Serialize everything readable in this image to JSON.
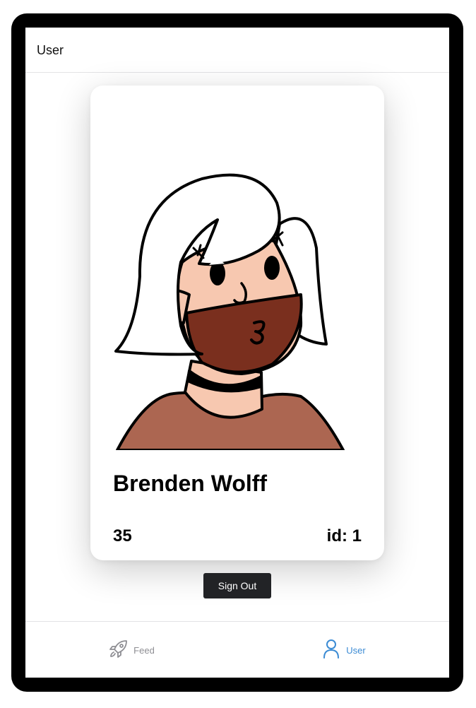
{
  "header": {
    "title": "User"
  },
  "profile": {
    "name": "Brenden Wolff",
    "age": "35",
    "id": "id: 1"
  },
  "actions": {
    "sign_out": "Sign Out"
  },
  "tabs": [
    {
      "label": "Feed",
      "icon": "rocket-icon",
      "active": false,
      "color": "#8e8e93"
    },
    {
      "label": "User",
      "icon": "person-icon",
      "active": true,
      "color": "#3b8bd4"
    }
  ],
  "colors": {
    "accent": "#3b8bd4",
    "button_bg": "#222326",
    "skin": "#f7c8b0",
    "beard": "#7a2f1e",
    "shirt": "#ac6651"
  }
}
